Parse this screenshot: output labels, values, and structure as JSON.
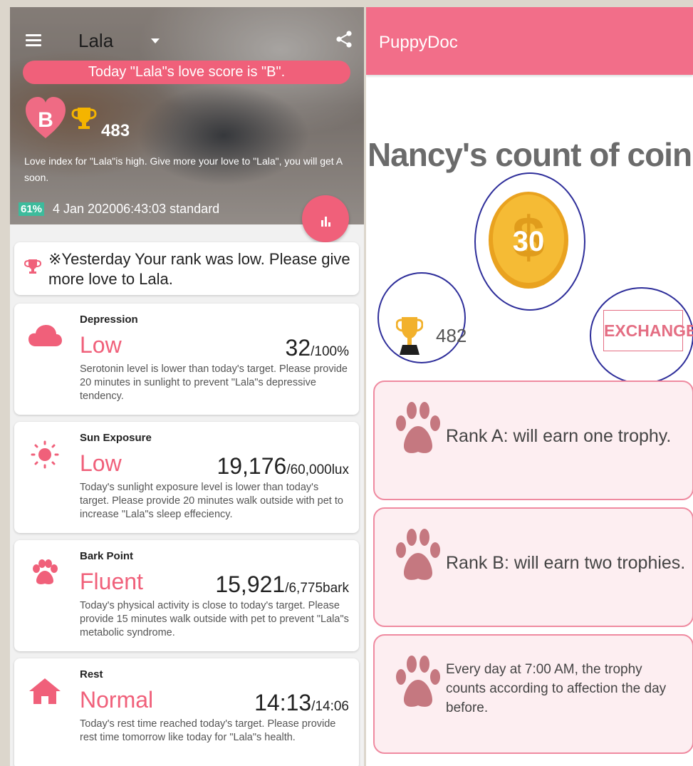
{
  "left": {
    "pet_name": "Lala",
    "banner": "Today \"Lala\"s love score is \"B\".",
    "grade": "B",
    "score": "483",
    "love_text": "Love index for \"Lala\"is high. Give more your love to \"Lala\", you will get A soon.",
    "battery_pct": "61%",
    "date": "4 Jan 202006:43:03 standard",
    "rank_message": "※Yesterday Your rank was low. Please give more love to Lala.",
    "metrics": [
      {
        "icon": "cloud-icon",
        "label": "Depression",
        "status": "Low",
        "value": "32",
        "target": "/100%",
        "desc": "Serotonin level is lower than today's target. Please provide 20 minutes in sunlight to prevent \"Lala\"s depressive tendency."
      },
      {
        "icon": "sun-icon",
        "label": "Sun Exposure",
        "status": "Low",
        "value": "19,176",
        "target": "/60,000lux",
        "desc": "Today's sunlight exposure level is lower than today's target. Please provide 20 minutes walk outside with pet to increase \"Lala\"s sleep effeciency."
      },
      {
        "icon": "paw-icon",
        "label": "Bark Point",
        "status": "Fluent",
        "value": "15,921",
        "target": "/6,775bark",
        "desc": "Today's physical activity is close to today's target. Please provide 15 minutes walk outside with pet to prevent \"Lala\"s metabolic syndrome."
      },
      {
        "icon": "home-icon",
        "label": "Rest",
        "status": "Normal",
        "value": "14:13",
        "target": "/14:06",
        "desc": "Today's rest time reached today's target. Please provide rest time tomorrow like today for \"Lala\"s health."
      }
    ]
  },
  "right": {
    "app_title": "PuppyDoc",
    "coin_title": "Nancy's count of coin",
    "coin_count": "30",
    "trophy_count": "482",
    "exchange_label": "EXCHANGE",
    "rules": [
      "Rank A: will earn one trophy.",
      "Rank B: will earn two trophies.",
      "Every day at 7:00 AM, the trophy counts according to affection the day before."
    ]
  },
  "colors": {
    "accent": "#f0607a",
    "appbar": "#f26e89",
    "ring": "#2e2e9a",
    "coin": "#f2b531",
    "paw": "#c57880"
  }
}
